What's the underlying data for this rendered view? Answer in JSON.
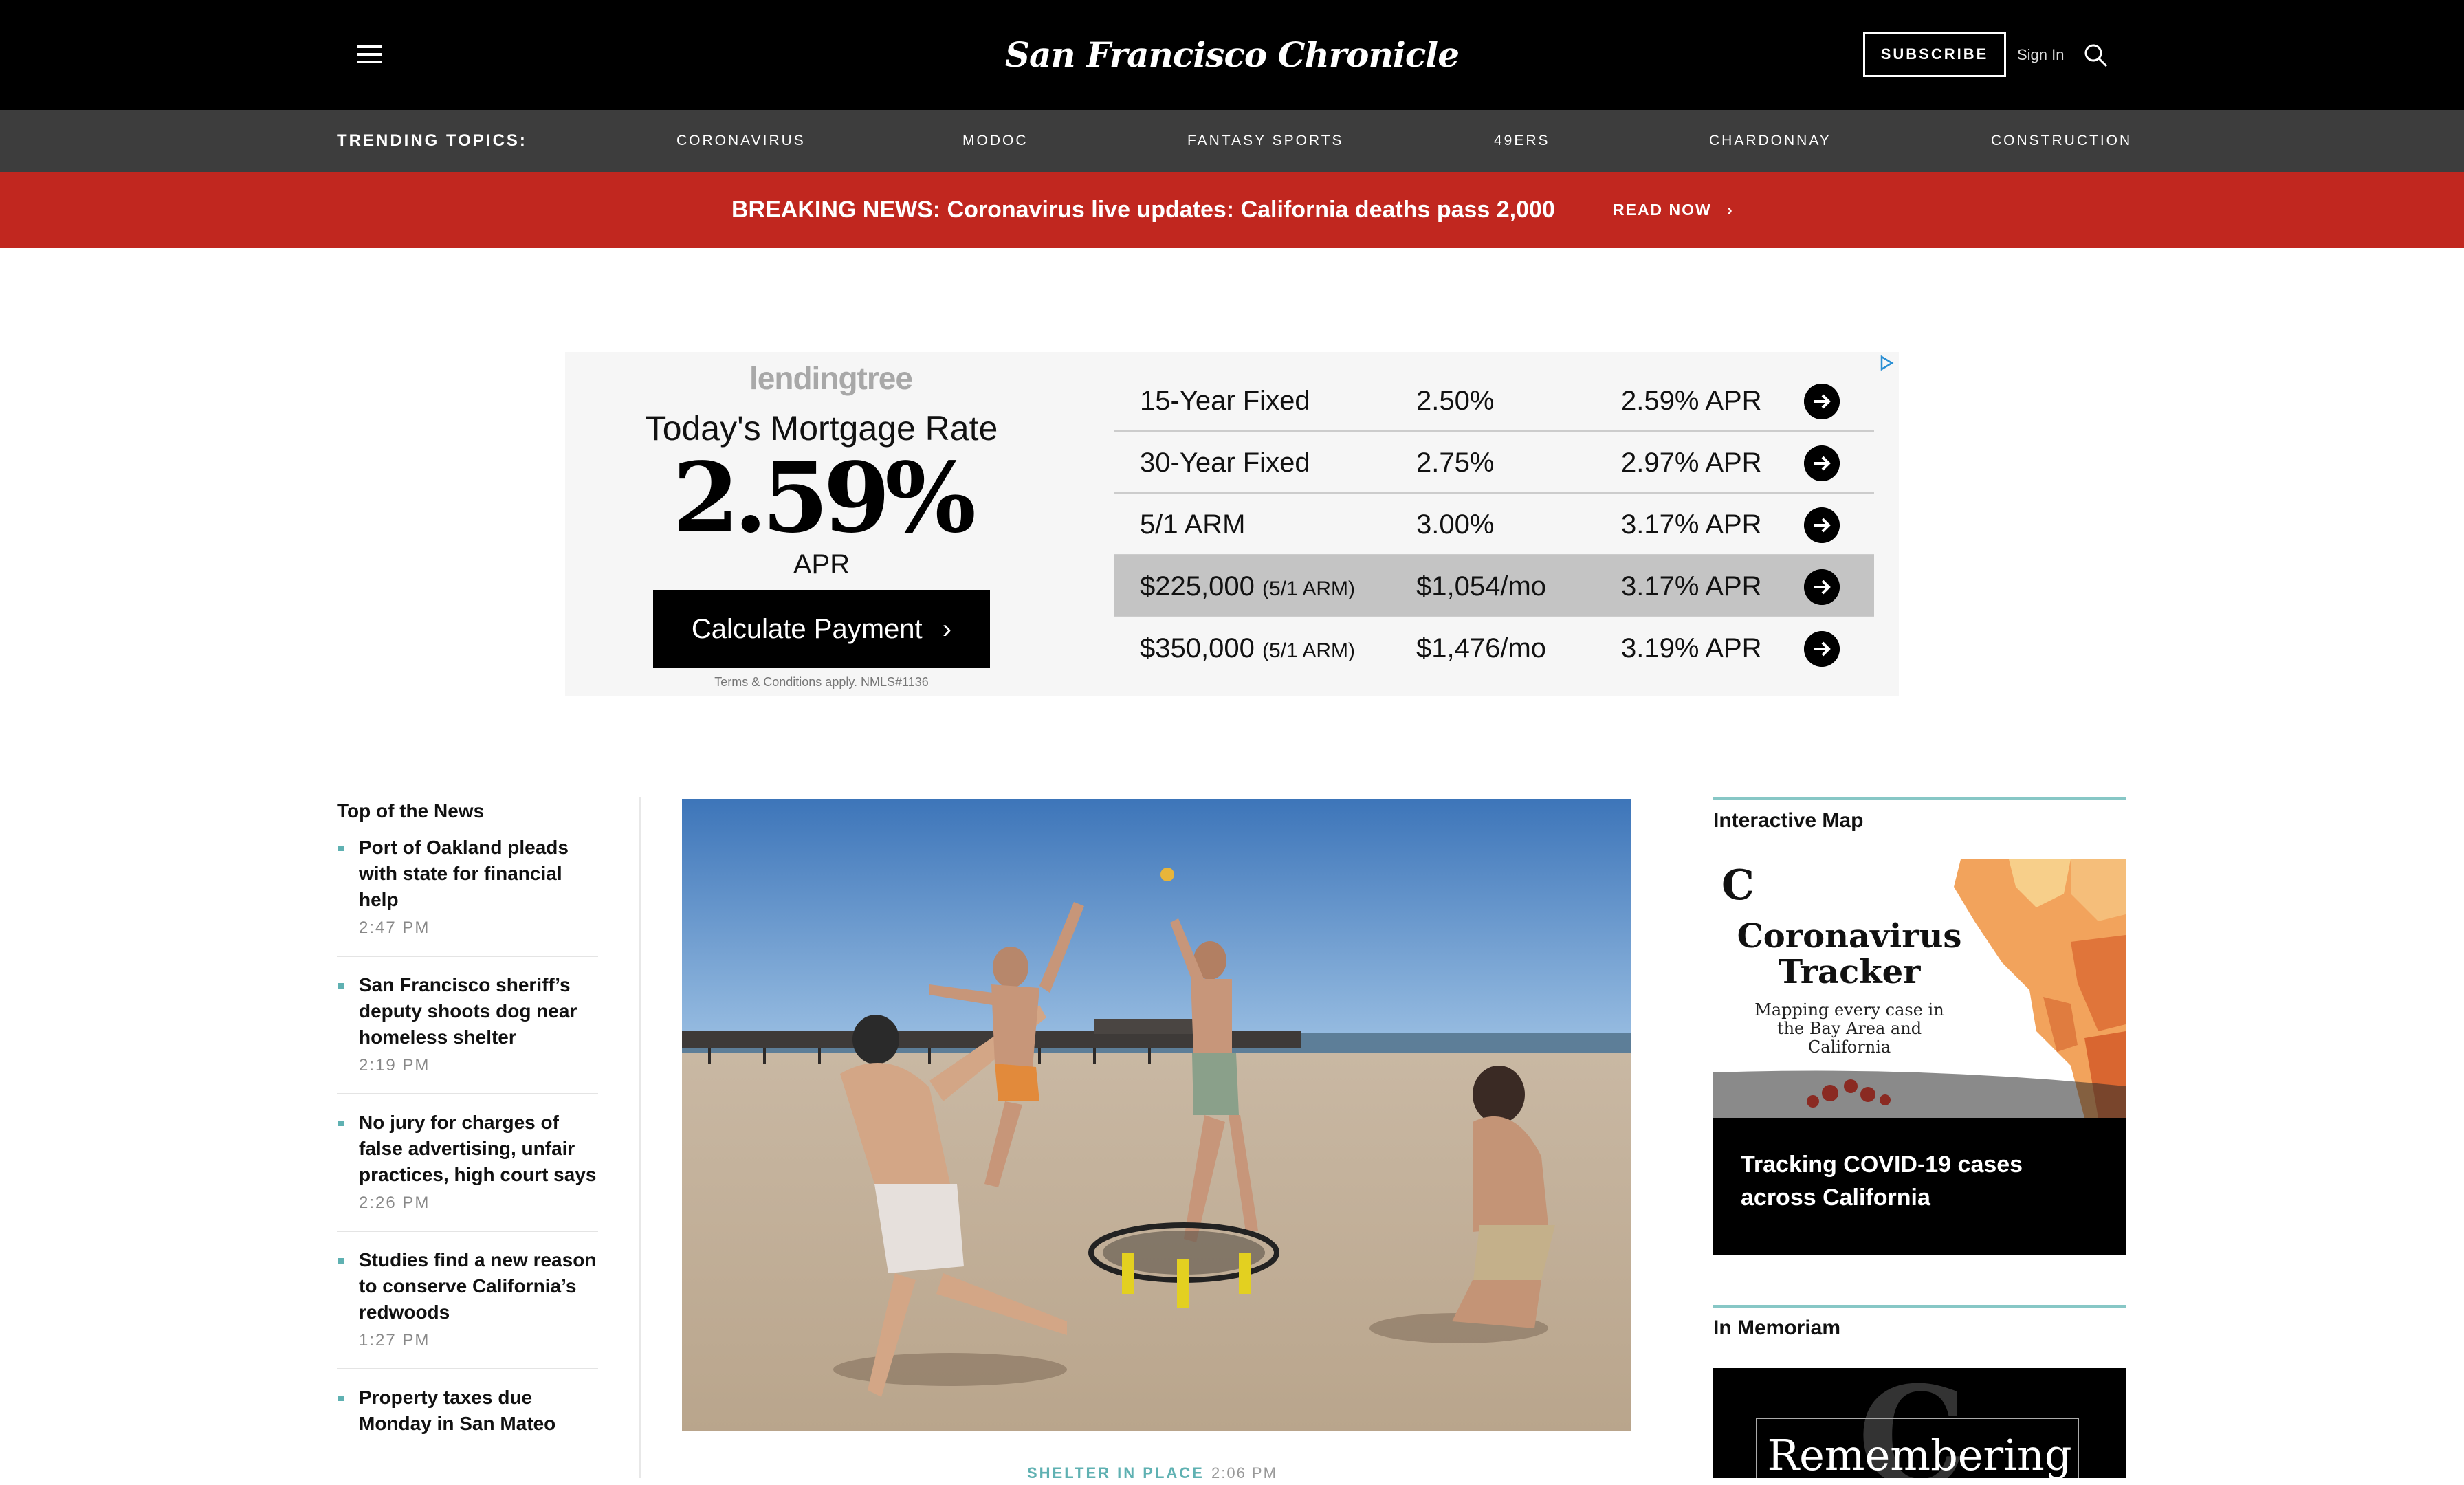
{
  "header": {
    "logo_text": "San Francisco Chronicle",
    "subscribe_label": "SUBSCRIBE",
    "signin_label": "Sign In"
  },
  "trending": {
    "label": "TRENDING TOPICS:",
    "topics": [
      "CORONAVIRUS",
      "MODOC",
      "FANTASY SPORTS",
      "49ERS",
      "CHARDONNAY",
      "CONSTRUCTION"
    ]
  },
  "breaking": {
    "text": "BREAKING NEWS: Coronavirus live updates: California deaths pass 2,000",
    "link_label": "READ NOW"
  },
  "ad": {
    "brand": "lendingtree",
    "headline": "Today's Mortgage Rate",
    "rate": "2.59%",
    "rate_unit": "APR",
    "cta": "Calculate Payment",
    "terms": "Terms & Conditions apply. NMLS#1136",
    "rows": [
      {
        "label": "15-Year Fixed",
        "sub": "",
        "rate": "2.50%",
        "apr": "2.59% APR"
      },
      {
        "label": "30-Year Fixed",
        "sub": "",
        "rate": "2.75%",
        "apr": "2.97% APR"
      },
      {
        "label": "5/1 ARM",
        "sub": "",
        "rate": "3.00%",
        "apr": "3.17% APR"
      },
      {
        "label": "$225,000",
        "sub": "(5/1 ARM)",
        "rate": "$1,054/mo",
        "apr": "3.17% APR"
      },
      {
        "label": "$350,000",
        "sub": "(5/1 ARM)",
        "rate": "$1,476/mo",
        "apr": "3.19% APR"
      }
    ]
  },
  "top_news": {
    "heading": "Top of the News",
    "items": [
      {
        "title": "Port of Oakland pleads with state for financial help",
        "time": "2:47 PM"
      },
      {
        "title": "San Francisco sheriff’s deputy shoots dog near homeless shelter",
        "time": "2:19 PM"
      },
      {
        "title": "No jury for charges of false advertising, unfair practices, high court says",
        "time": "2:26 PM"
      },
      {
        "title": "Studies find a new reason to conserve California’s redwoods",
        "time": "1:27 PM"
      },
      {
        "title": "Property taxes due Monday in San Mateo",
        "time": ""
      }
    ]
  },
  "main_story": {
    "kicker": "SHELTER IN PLACE",
    "time": "2:06 PM"
  },
  "right": {
    "map_heading": "Interactive Map",
    "tracker_title": "Coronavirus Tracker",
    "tracker_subtitle": "Mapping every case in the Bay Area and California",
    "map_caption": "Tracking COVID-19 cases across California",
    "memoriam_heading": "In Memoriam",
    "memoriam_text": "Remembering"
  },
  "colors": {
    "breaking_red": "#c1271f",
    "trending_gray": "#3d3d3d",
    "accent_teal": "#5fb1b2"
  }
}
